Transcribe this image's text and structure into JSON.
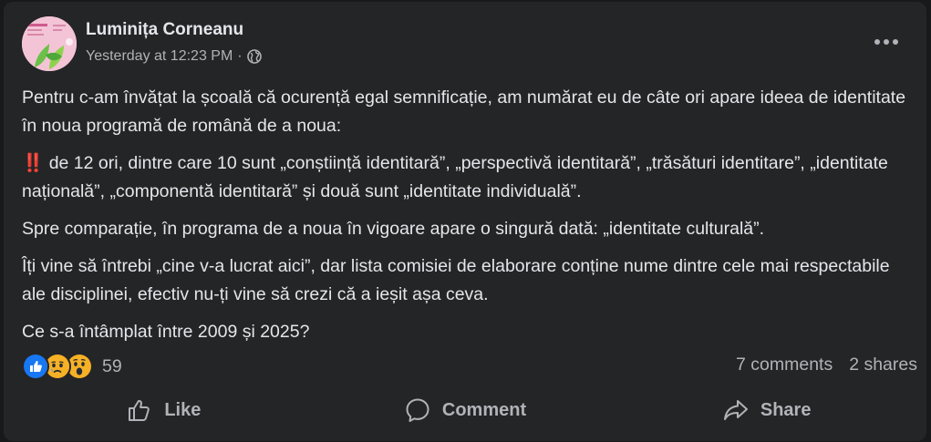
{
  "post": {
    "author": "Luminița Corneanu",
    "timestamp": "Yesterday at 12:23 PM",
    "separator": "·",
    "privacy_icon": "globe-icon",
    "more_icon": "more-horizontal-icon",
    "paragraphs": {
      "p1": "Pentru c-am învățat la școală că ocurență egal semnificație, am numărat eu de câte ori apare ideea de identitate în noua programă de română de a noua:",
      "p2_emoji": "‼️",
      "p2": "de 12 ori, dintre care 10 sunt „conștiință identitară”, „perspectivă identitară”, „trăsături identitare”, „identitate națională”, „componentă identitară” și două sunt „identitate individuală”.",
      "p3": "Spre comparație, în programa de a noua în vigoare apare o singură dată: „identitate culturală”.",
      "p4": "Îți vine să întrebi „cine v-a lucrat aici”, dar lista comisiei de elaborare conține nume dintre cele mai respectabile ale disciplinei, efectiv nu-ți vine să crezi că a ieșit așa ceva.",
      "p5": "Ce s-a întâmplat între 2009 și 2025?"
    }
  },
  "stats": {
    "reaction_icons": [
      "like-icon",
      "sad-icon",
      "wow-icon"
    ],
    "reaction_count": "59",
    "comments": "7 comments",
    "shares": "2 shares"
  },
  "actions": {
    "like": "Like",
    "comment": "Comment",
    "share": "Share"
  },
  "colors": {
    "card_bg": "#242526",
    "page_bg": "#18191a",
    "text_primary": "#e4e6eb",
    "text_secondary": "#b0b3b8",
    "like_blue": "#1877f2",
    "emoji_yellow": "#f7b125",
    "alert_red": "#e41e3f"
  }
}
